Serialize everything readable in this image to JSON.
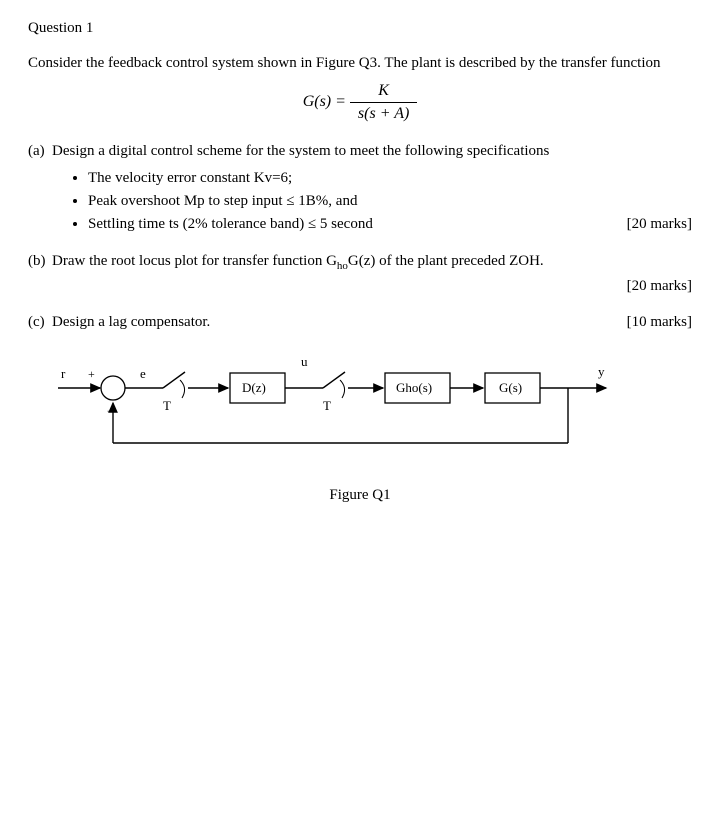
{
  "question_title": "Question 1",
  "intro": "Consider the feedback control system shown in Figure Q3. The plant is described by the transfer function",
  "formula": {
    "lhs": "G(s) =",
    "num": "K",
    "den": "s(s + A)"
  },
  "parts": {
    "a": {
      "label": "(a)",
      "text": "Design a digital control scheme for the system to meet the following specifications",
      "bullets": [
        "The velocity error constant Kv=6;",
        "Peak overshoot Mp to step input ≤ 1B%, and",
        "Settling time ts (2% tolerance band) ≤ 5  second"
      ],
      "marks": "[20 marks]"
    },
    "b": {
      "label": "(b)",
      "text_before": "Draw the root locus plot for transfer function G",
      "sub": "ho",
      "text_after": "G(z) of the plant preceded ZOH.",
      "marks": "[20 marks]"
    },
    "c": {
      "label": "(c)",
      "text": "Design a lag compensator.",
      "marks": "[10 marks]"
    }
  },
  "diagram": {
    "labels": {
      "r": "r",
      "plus": "+",
      "e": "e",
      "T1": "T",
      "Dz": "D(z)",
      "u": "u",
      "T2": "T",
      "Gho": "Gho(s)",
      "Gs": "G(s)",
      "y": "y"
    }
  },
  "figure_caption": "Figure Q1"
}
